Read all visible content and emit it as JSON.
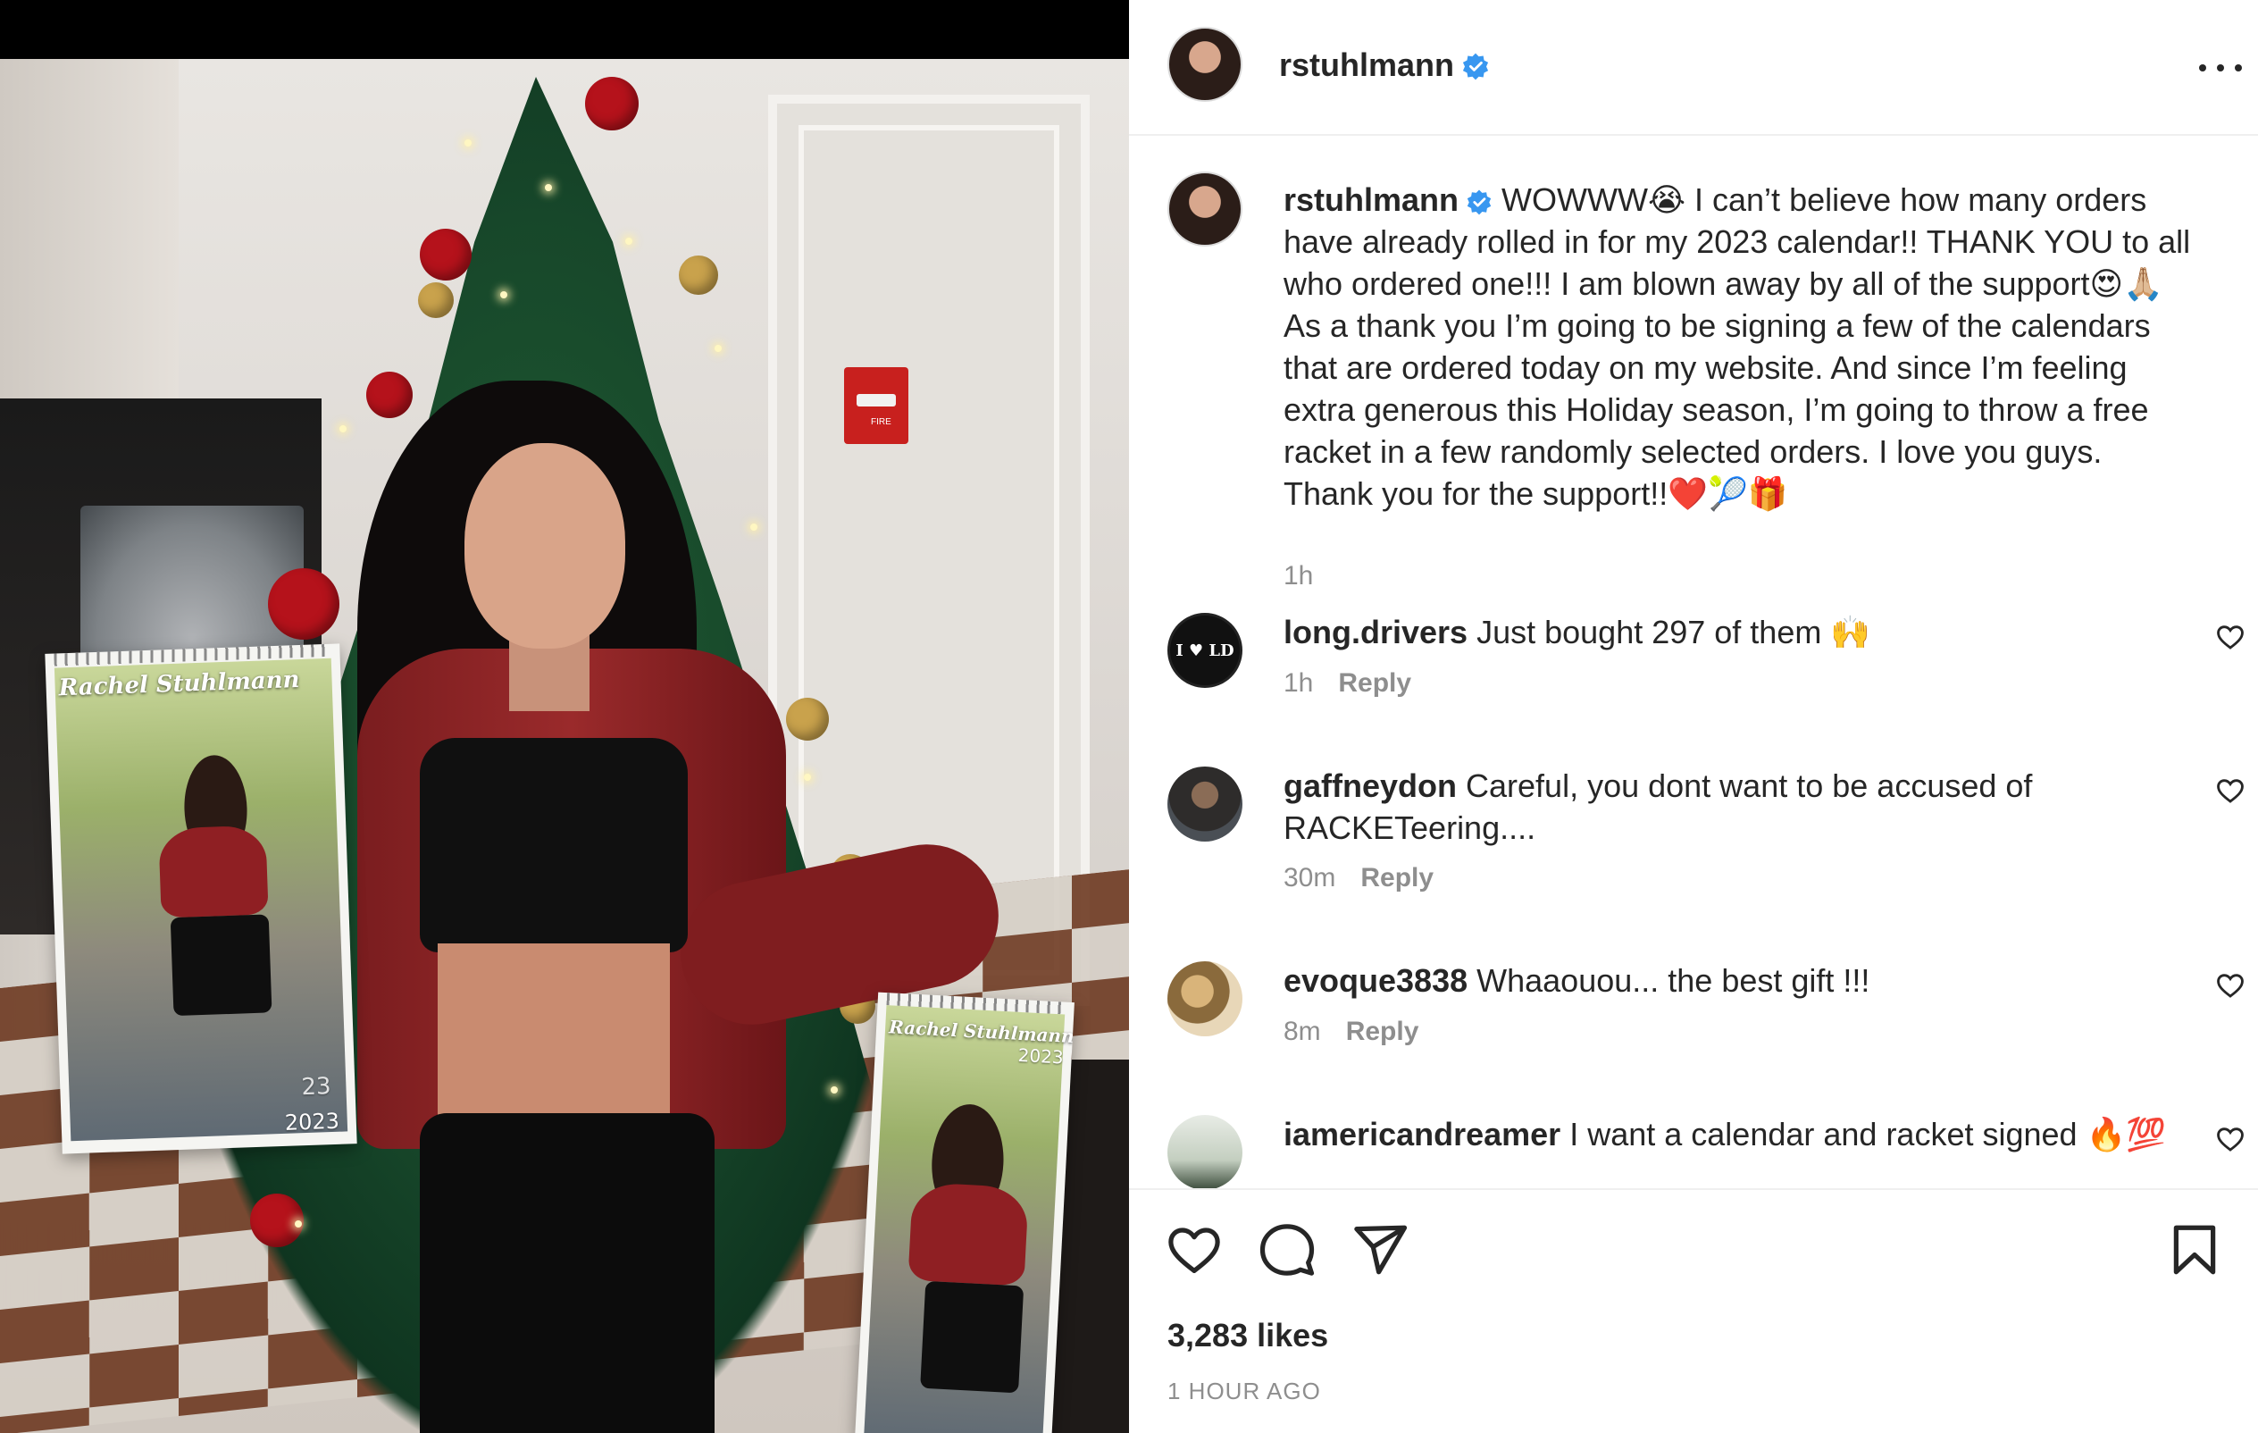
{
  "post": {
    "username": "rstuhlmann",
    "verified": true,
    "caption": "WOWWW😭 I can’t believe how many orders have already rolled in for my 2023 calendar!! THANK YOU to all who ordered one!!! I am blown away by all of the support😍🙏🏼 As a thank you I’m going to be signing a few of the calendars that are ordered today on my website. And since I’m feeling extra generous this Holiday season, I’m going to throw a free racket in a few randomly selected orders. I love you guys. Thank you for the support!!❤️🎾🎁",
    "caption_time": "1h",
    "likes": "3,283 likes",
    "posted_ago": "1 HOUR AGO"
  },
  "photo": {
    "calendar_title": "Rachel Stuhlmann",
    "calendar_year": "2023",
    "calendar_year_short": "23",
    "alarm_label": "FIRE"
  },
  "comments": [
    {
      "username": "long.drivers",
      "text": "Just bought 297 of them 🙌",
      "time": "1h",
      "reply": "Reply",
      "avatar_text": "I ♥ LD"
    },
    {
      "username": "gaffneydon",
      "text": "Careful, you dont want to be accused of RACKETeering....",
      "time": "30m",
      "reply": "Reply"
    },
    {
      "username": "evoque3838",
      "text": "Whaaouou... the best gift !!!",
      "time": "8m",
      "reply": "Reply"
    },
    {
      "username": "iamericandreamer",
      "text": "I want a calendar and racket signed 🔥💯",
      "time": "",
      "reply": ""
    }
  ],
  "icons": {
    "more": "more-options-icon",
    "like": "heart-icon",
    "comment": "comment-bubble-icon",
    "share": "paper-plane-icon",
    "save": "bookmark-icon",
    "verified": "verified-badge-icon"
  },
  "colors": {
    "verified_blue": "#3897f0",
    "text_primary": "#262626",
    "text_secondary": "#8e8e8e",
    "divider": "#efefef"
  }
}
